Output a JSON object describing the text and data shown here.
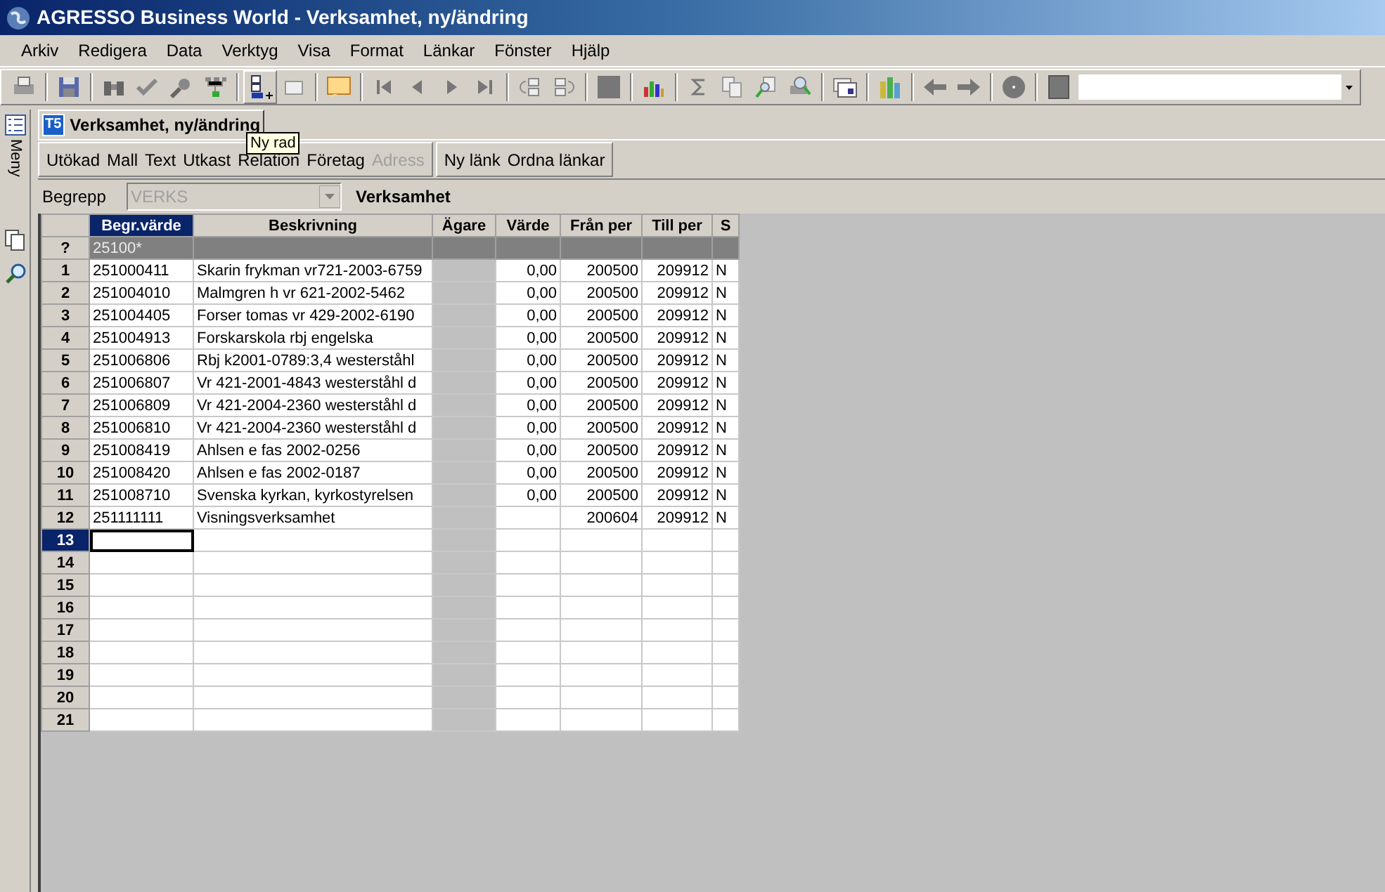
{
  "window": {
    "title": "AGRESSO Business World - Verksamhet, ny/ändring"
  },
  "menu": [
    "Arkiv",
    "Redigera",
    "Data",
    "Verktyg",
    "Visa",
    "Format",
    "Länkar",
    "Fönster",
    "Hjälp"
  ],
  "side_panel": {
    "label": "Meny"
  },
  "tab": {
    "badge": "T5",
    "label": "Verksamhet, ny/ändring"
  },
  "tooltip": "Ny rad",
  "actions": [
    {
      "label": "Utökad",
      "disabled": false
    },
    {
      "label": "Mall",
      "disabled": false
    },
    {
      "label": "Text",
      "disabled": false
    },
    {
      "label": "Utkast",
      "disabled": false
    },
    {
      "label": "Relation",
      "disabled": false
    },
    {
      "label": "Företag",
      "disabled": false
    },
    {
      "label": "Adress",
      "disabled": true
    }
  ],
  "link_actions": [
    "Ny länk",
    "Ordna länkar"
  ],
  "filter": {
    "label": "Begrepp",
    "value": "VERKS",
    "disabled": true,
    "caption": "Verksamhet"
  },
  "table": {
    "columns": [
      {
        "label": "Begr.värde",
        "selected": true
      },
      {
        "label": "Beskrivning",
        "selected": false
      },
      {
        "label": "Ägare",
        "selected": false
      },
      {
        "label": "Värde",
        "selected": false
      },
      {
        "label": "Från per",
        "selected": false
      },
      {
        "label": "Till per",
        "selected": false
      },
      {
        "label": "S",
        "selected": false
      }
    ],
    "filter_row": {
      "header": "?",
      "code": "25100*"
    },
    "rows": [
      {
        "n": "1",
        "code": "251000411",
        "description": "Skarin frykman vr721-2003-6759",
        "value": "0,00",
        "from": "200500",
        "to": "209912",
        "s": "N",
        "selected": false
      },
      {
        "n": "2",
        "code": "251004010",
        "description": "Malmgren h vr 621-2002-5462",
        "value": "0,00",
        "from": "200500",
        "to": "209912",
        "s": "N",
        "selected": false
      },
      {
        "n": "3",
        "code": "251004405",
        "description": "Forser tomas vr 429-2002-6190",
        "value": "0,00",
        "from": "200500",
        "to": "209912",
        "s": "N",
        "selected": false
      },
      {
        "n": "4",
        "code": "251004913",
        "description": "Forskarskola rbj engelska",
        "value": "0,00",
        "from": "200500",
        "to": "209912",
        "s": "N",
        "selected": false
      },
      {
        "n": "5",
        "code": "251006806",
        "description": "Rbj k2001-0789:3,4 westerståhl",
        "value": "0,00",
        "from": "200500",
        "to": "209912",
        "s": "N",
        "selected": false
      },
      {
        "n": "6",
        "code": "251006807",
        "description": "Vr 421-2001-4843 westerståhl d",
        "value": "0,00",
        "from": "200500",
        "to": "209912",
        "s": "N",
        "selected": false
      },
      {
        "n": "7",
        "code": "251006809",
        "description": "Vr 421-2004-2360 westerståhl d",
        "value": "0,00",
        "from": "200500",
        "to": "209912",
        "s": "N",
        "selected": false
      },
      {
        "n": "8",
        "code": "251006810",
        "description": "Vr 421-2004-2360 westerståhl d",
        "value": "0,00",
        "from": "200500",
        "to": "209912",
        "s": "N",
        "selected": false
      },
      {
        "n": "9",
        "code": "251008419",
        "description": "Ahlsen e fas 2002-0256",
        "value": "0,00",
        "from": "200500",
        "to": "209912",
        "s": "N",
        "selected": false
      },
      {
        "n": "10",
        "code": "251008420",
        "description": "Ahlsen e fas 2002-0187",
        "value": "0,00",
        "from": "200500",
        "to": "209912",
        "s": "N",
        "selected": false
      },
      {
        "n": "11",
        "code": "251008710",
        "description": "Svenska kyrkan, kyrkostyrelsen",
        "value": "0,00",
        "from": "200500",
        "to": "209912",
        "s": "N",
        "selected": false
      },
      {
        "n": "12",
        "code": "251111111",
        "description": "Visningsverksamhet",
        "from": "200604",
        "to": "209912",
        "s": "N",
        "selected": false
      },
      {
        "n": "13",
        "selected": true
      },
      {
        "n": "14",
        "selected": false
      },
      {
        "n": "15",
        "selected": false
      },
      {
        "n": "16",
        "selected": false
      },
      {
        "n": "17",
        "selected": false
      },
      {
        "n": "18",
        "selected": false
      },
      {
        "n": "19",
        "selected": false
      },
      {
        "n": "20",
        "selected": false
      },
      {
        "n": "21",
        "selected": false
      }
    ]
  }
}
